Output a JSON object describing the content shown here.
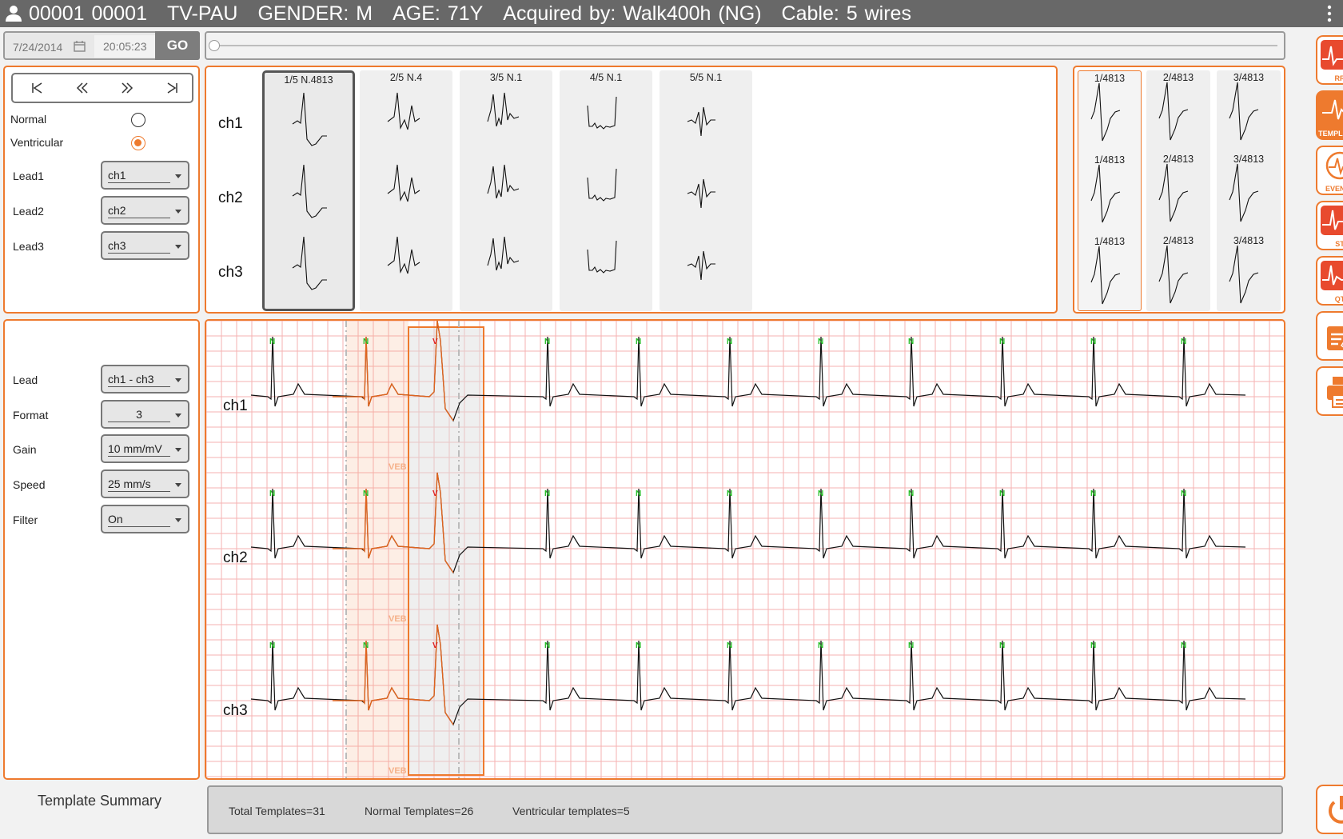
{
  "header": {
    "patient_id": "00001 00001",
    "unit": "TV-PAU",
    "gender": "GENDER: M",
    "age": "AGE: 71Y",
    "acquired": "Acquired by: Walk400h (NG)",
    "cable": "Cable: 5 wires"
  },
  "timebar": {
    "date": "7/24/2014",
    "time": "20:05:23",
    "go_label": "GO",
    "slider_position": 0.0
  },
  "controls": {
    "normal_label": "Normal",
    "ventricular_label": "Ventricular",
    "selected_type": "Ventricular",
    "lead1_label": "Lead1",
    "lead1_value": "ch1",
    "lead2_label": "Lead2",
    "lead2_value": "ch2",
    "lead3_label": "Lead3",
    "lead3_value": "ch3"
  },
  "display_settings": {
    "lead_label": "Lead",
    "lead_value": "ch1 - ch3",
    "format_label": "Format",
    "format_value": "3",
    "gain_label": "Gain",
    "gain_value": "10 mm/mV",
    "speed_label": "Speed",
    "speed_value": "25 mm/s",
    "filter_label": "Filter",
    "filter_value": "On"
  },
  "templates": {
    "channels": [
      "ch1",
      "ch2",
      "ch3"
    ],
    "columns": [
      "1/5 N.4813",
      "2/5 N.4",
      "3/5 N.1",
      "4/5 N.1",
      "5/5 N.1"
    ],
    "selected_index": 0
  },
  "beats": {
    "headers": [
      "1/4813",
      "2/4813",
      "3/4813"
    ]
  },
  "strip": {
    "channels": [
      "ch1",
      "ch2",
      "ch3"
    ],
    "beat_markers": [
      "N",
      "N",
      "V",
      "N",
      "N",
      "N",
      "N",
      "N",
      "N",
      "N",
      "N"
    ],
    "annotation": "VEB"
  },
  "sidebar": {
    "rr": "RR",
    "templates": "TEMPLATES",
    "events": "EVENTS",
    "st": "ST",
    "qt": "QT"
  },
  "summary": {
    "title": "Template Summary",
    "total": "Total Templates=31",
    "normal": "Normal Templates=26",
    "ventricular": "Ventricular templates=5"
  },
  "colors": {
    "accent": "#ee7a2e",
    "grid": "#f6b2b2",
    "normal_marker": "#22bb22",
    "v_marker": "#e02020"
  },
  "icons": [
    "user-icon",
    "menu-icon",
    "calendar-icon",
    "first-icon",
    "prev-icon",
    "next-icon",
    "last-icon",
    "edit-icon",
    "print-icon",
    "power-icon"
  ]
}
